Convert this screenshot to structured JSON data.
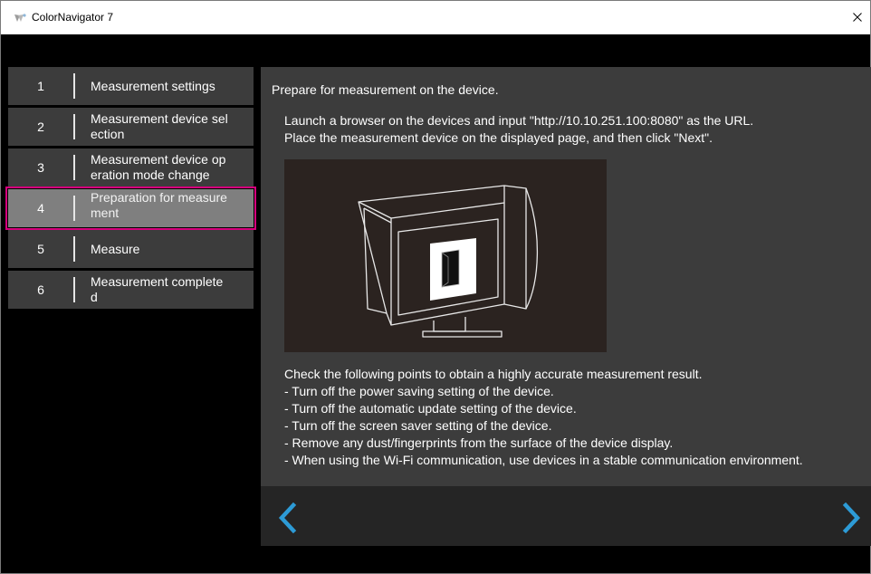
{
  "window": {
    "title": "ColorNavigator 7",
    "close_glyph": "✕"
  },
  "steps": [
    {
      "number": "1",
      "label_lines": [
        "Measurement settings"
      ],
      "state": "normal"
    },
    {
      "number": "2",
      "label_lines": [
        "Measurement device sel",
        "ection"
      ],
      "state": "normal"
    },
    {
      "number": "3",
      "label_lines": [
        "Measurement device op",
        "eration mode change"
      ],
      "state": "normal"
    },
    {
      "number": "4",
      "label_lines": [
        "Preparation for measure",
        "ment"
      ],
      "state": "active"
    },
    {
      "number": "5",
      "label_lines": [
        "Measure"
      ],
      "state": "normal"
    },
    {
      "number": "6",
      "label_lines": [
        "Measurement complete",
        "d"
      ],
      "state": "normal"
    }
  ],
  "main": {
    "heading": "Prepare for measurement on the device.",
    "instruction_lines": [
      "Launch a browser on the devices and input \"http://10.10.251.100:8080\" as the URL.",
      "Place the measurement device on the displayed page, and then click \"Next\"."
    ],
    "illustration": "monitor-with-measurement-patch",
    "checklist": [
      "Check the following points to obtain a highly accurate measurement result.",
      "- Turn off the power saving setting of the device.",
      "- Turn off the automatic update setting of the device.",
      "- Turn off the screen saver setting of the device.",
      "- Remove any dust/fingerprints from the surface of the device display.",
      "- When using the Wi-Fi communication, use devices in a stable communication environment."
    ]
  },
  "nav": {
    "back_icon": "chevron-left-icon",
    "next_icon": "chevron-right-icon",
    "accent_color": "#2d9bd6"
  },
  "colors": {
    "active_outline": "#d6007d",
    "panel_bg": "#3c3c3c",
    "active_step_bg": "#7f7f7f"
  }
}
